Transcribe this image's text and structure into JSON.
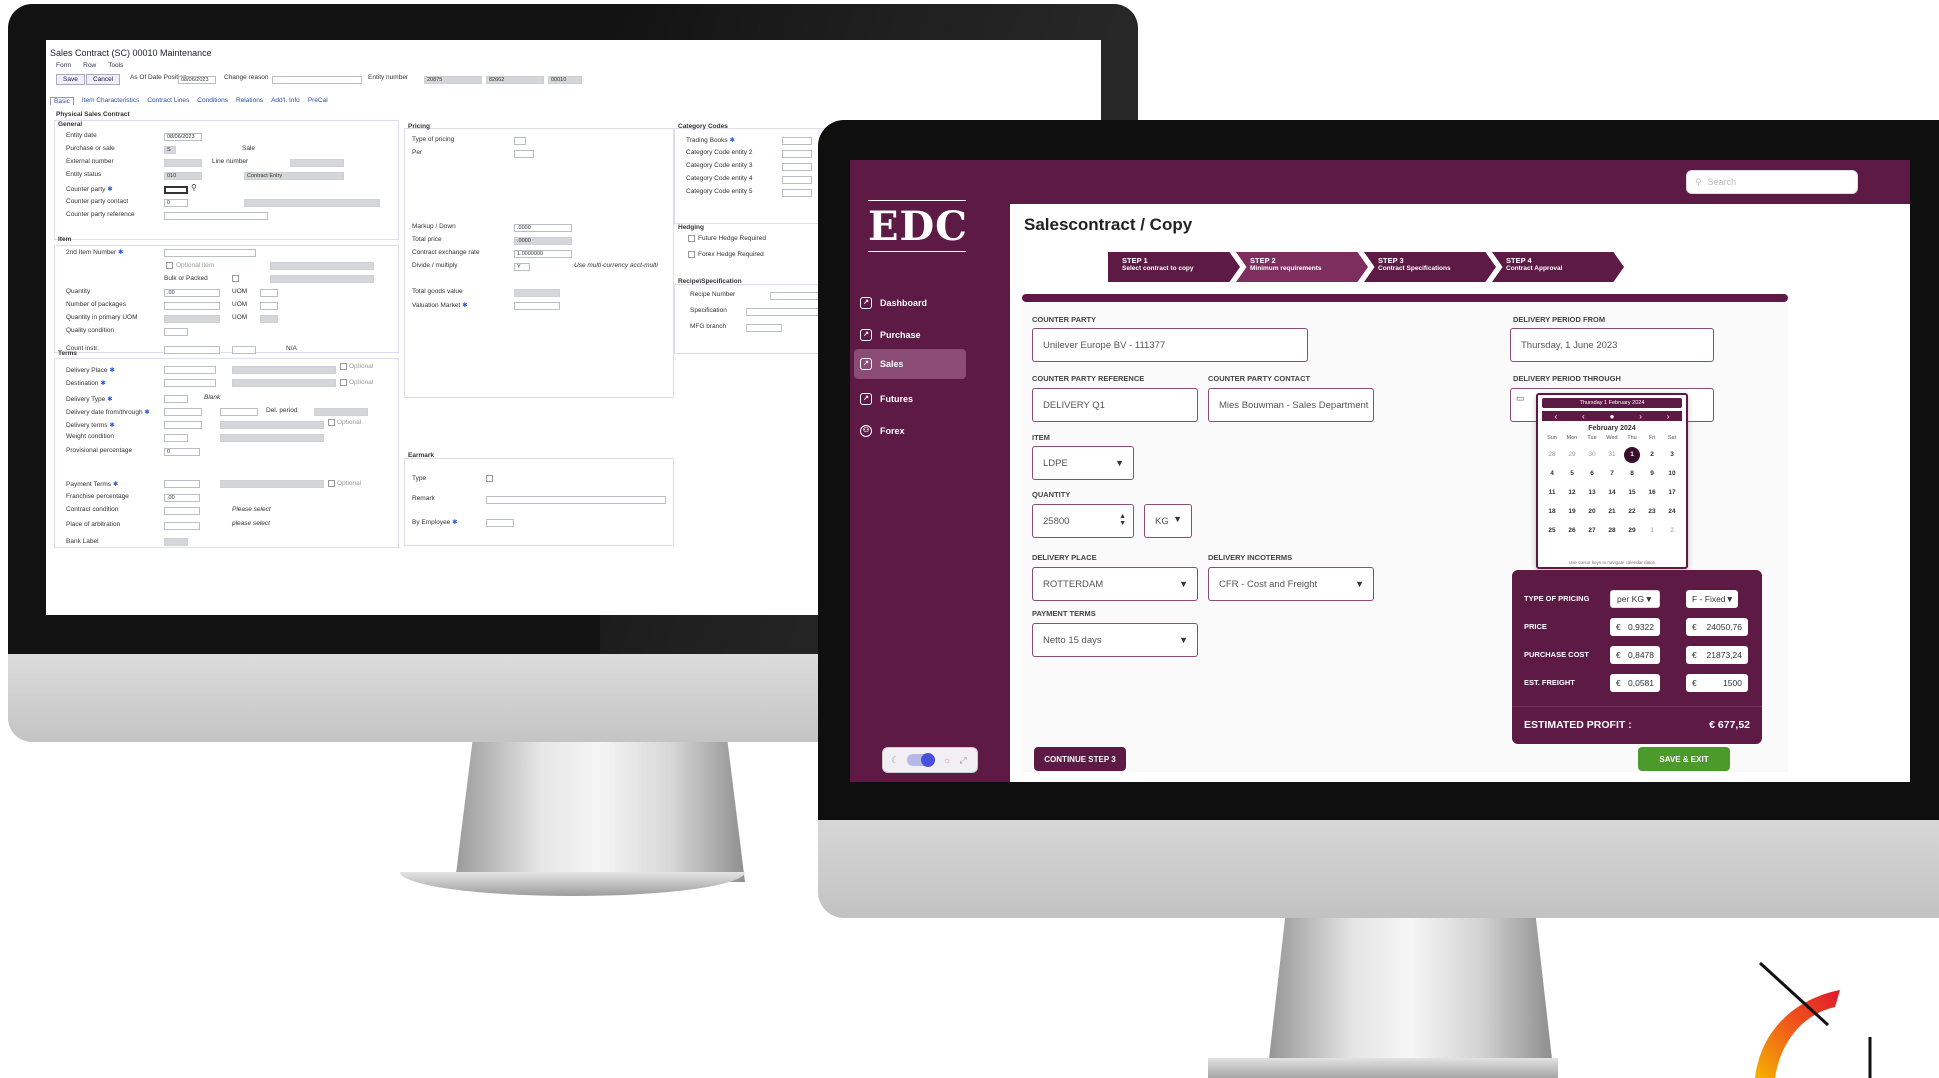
{
  "legacy": {
    "title": "Sales Contract (SC) 00010 Maintenance",
    "menu": [
      "Form",
      "Row",
      "Tools"
    ],
    "toolbar": {
      "save": "Save",
      "cancel": "Cancel",
      "as_of_date_label": "As Of Date Position",
      "as_of_date_value": "08/06/2023",
      "change_reason_label": "Change reason",
      "entity_number_label": "Entity number",
      "entity_number_values": [
        "20875",
        "82662",
        "00010"
      ]
    },
    "tabs": [
      "Basic",
      "Item Characteristics",
      "Contract Lines",
      "Conditions",
      "Relations",
      "Add'l. Info",
      "PreCal"
    ],
    "section_title": "Physical Sales Contract",
    "general": {
      "title": "General",
      "entity_date_label": "Entity date",
      "entity_date_value": "08/06/2023",
      "purchase_or_sale_label": "Purchase or sale",
      "purchase_or_sale_value": "S",
      "purchase_or_sale_text": "Sale",
      "external_number_label": "External number",
      "line_number_label": "Line number",
      "entity_status_label": "Entity status",
      "entity_status_value": "010",
      "entity_status_text": "Contract Entry",
      "counter_party_label": "Counter party",
      "counter_party_contact_label": "Counter party contact",
      "counter_party_contact_value": "0",
      "counter_party_reference_label": "Counter party reference"
    },
    "item": {
      "title": "Item",
      "item_number_label": "2nd Item Number",
      "optional_item": "Optional item",
      "bulk_label": "Bulk or Packed",
      "quantity_label": "Quantity",
      "quantity_value": ".00",
      "packages_label": "Number of packages",
      "primary_uom_label": "Quantity in primary UOM",
      "uom": "UOM",
      "quality_label": "Quality condition",
      "count_instr_label": "Count instr.",
      "na": "N/A"
    },
    "terms": {
      "title": "Terms",
      "delivery_place": "Delivery Place",
      "destination": "Destination",
      "delivery_type": "Delivery Type",
      "blank": "Blank",
      "delivery_date": "Delivery date from/through",
      "del_period": "Del. period",
      "delivery_terms": "Delivery terms",
      "weight_condition": "Weight condition",
      "provisional_pct": "Provisional percentage",
      "provisional_value": "0",
      "payment_terms": "Payment Terms",
      "franchise_pct": "Franchise percentage",
      "franchise_value": ".00",
      "contract_condition": "Contract condition",
      "place_arbitration": "Place of arbitration",
      "bank_label": "Bank Label",
      "please_select": "Please select",
      "please_select_2": "please select",
      "optional": "Optional"
    },
    "pricing": {
      "title": "Pricing",
      "type_label": "Type of pricing",
      "per_label": "Per",
      "markup_label": "Markup / Down",
      "markup_value": ".0000",
      "total_price_label": "Total price",
      "total_price_value": ".0000",
      "exchange_label": "Contract exchange rate",
      "exchange_value": "1.0000000",
      "divide_label": "Divide / multiply",
      "divide_value": "Y",
      "multi_currency": "Use multi-currency acct-multi",
      "goods_value_label": "Total goods value",
      "valuation_label": "Valuation Market"
    },
    "category": {
      "title": "Category Codes",
      "items": [
        "Trading Books",
        "Category Code entity 2",
        "Category Code entity 3",
        "Category Code entity 4",
        "Category Code entity 5"
      ]
    },
    "hedging": {
      "title": "Hedging",
      "future": "Future Hedge Required",
      "forex": "Forex Hedge Required"
    },
    "recipe": {
      "title": "Recipe\\Specification",
      "recipe_number": "Recipe Number",
      "specification": "Specification",
      "mfg_branch": "MFG branch"
    },
    "earmark": {
      "title": "Earmark",
      "type": "Type",
      "remark": "Remark",
      "by_employee": "By Employee"
    }
  },
  "app": {
    "logo": "EDC",
    "search_placeholder": "Search",
    "nav": [
      "Dashboard",
      "Purchase",
      "Sales",
      "Futures",
      "Forex"
    ],
    "active_nav": "Sales",
    "page_title": "Salescontract / Copy",
    "steps": [
      {
        "num": "STEP 1",
        "label": "Select contract to copy"
      },
      {
        "num": "STEP 2",
        "label": "Minimum requirements"
      },
      {
        "num": "STEP 3",
        "label": "Contract Specifications"
      },
      {
        "num": "STEP 4",
        "label": "Contract Approval"
      }
    ],
    "active_step": "STEP 2",
    "form": {
      "counter_party_label": "COUNTER PARTY",
      "counter_party_value": "Unilever Europe BV - 111377",
      "cp_reference_label": "COUNTER PARTY REFERENCE",
      "cp_reference_value": "DELIVERY Q1",
      "cp_contact_label": "COUNTER PARTY CONTACT",
      "cp_contact_value": "Mies Bouwman - Sales Department",
      "item_label": "ITEM",
      "item_value": "LDPE",
      "quantity_label": "QUANTITY",
      "quantity_value": "25800",
      "unit_value": "KG",
      "delivery_place_label": "DELIVERY PLACE",
      "delivery_place_value": "ROTTERDAM",
      "incoterms_label": "DELIVERY INCOTERMS",
      "incoterms_value": "CFR - Cost and Freight",
      "payment_terms_label": "PAYMENT TERMS",
      "payment_terms_value": "Netto 15 days",
      "period_from_label": "DELIVERY PERIOD FROM",
      "period_from_value": "Thursday, 1 June 2023",
      "period_through_label": "DELIVERY PERIOD THROUGH"
    },
    "calendar": {
      "header": "Thursday 1 February 2024",
      "month": "February 2024",
      "weekdays": [
        "Sun",
        "Mon",
        "Tue",
        "Wed",
        "Thu",
        "Fri",
        "Sat"
      ],
      "weeks": [
        [
          "28",
          "29",
          "30",
          "31",
          "1",
          "2",
          "3"
        ],
        [
          "4",
          "5",
          "6",
          "7",
          "8",
          "9",
          "10"
        ],
        [
          "11",
          "12",
          "13",
          "14",
          "15",
          "16",
          "17"
        ],
        [
          "18",
          "19",
          "20",
          "21",
          "22",
          "23",
          "24"
        ],
        [
          "25",
          "26",
          "27",
          "28",
          "29",
          "1",
          "2"
        ]
      ],
      "selected": "1",
      "hint": "Use cursor keys to navigate calendar dates"
    },
    "pricing": {
      "type_label": "TYPE OF PRICING",
      "per_value": "per KG",
      "type_value": "F - Fixed",
      "price_label": "PRICE",
      "price_unit": "0,9322",
      "price_total": "24050,76",
      "purchase_cost_label": "PURCHASE COST",
      "purchase_cost_unit": "0,8478",
      "purchase_cost_total": "21873,24",
      "freight_label": "EST. FREIGHT",
      "freight_unit": "0,0581",
      "freight_total": "1500",
      "currency": "€",
      "profit_label": "ESTIMATED PROFIT :",
      "profit_value": "€  677,52"
    },
    "buttons": {
      "continue": "CONTINUE STEP 3",
      "save_exit": "SAVE & EXIT"
    },
    "colors": {
      "brand": "#5d1a45",
      "brand_light": "#8a4b75",
      "save_button": "#4c9a2a"
    }
  }
}
